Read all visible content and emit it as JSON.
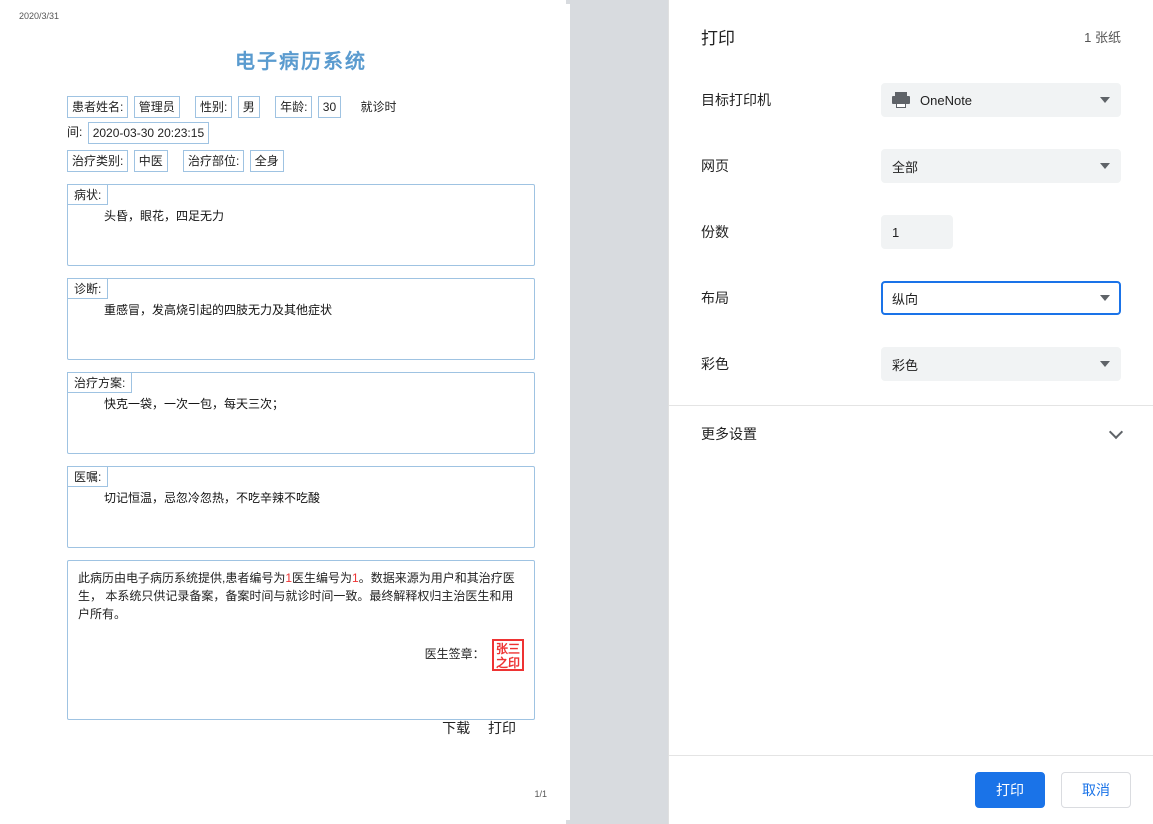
{
  "preview": {
    "date": "2020/3/31",
    "pageCounter": "1/1",
    "title": "电子病历系统",
    "patient": {
      "nameLabel": "患者姓名:",
      "nameValue": "管理员",
      "genderLabel": "性别:",
      "genderValue": "男",
      "ageLabel": "年龄:",
      "ageValue": "30",
      "visitTimeLabel1": "就诊时",
      "visitTimeLabel2": "间:",
      "visitTimeValue": "2020-03-30 20:23:15",
      "categoryLabel": "治疗类别:",
      "categoryValue": "中医",
      "partLabel": "治疗部位:",
      "partValue": "全身"
    },
    "sections": {
      "symptomLabel": "病状:",
      "symptomText": "头昏，眼花，四足无力",
      "diagnosisLabel": "诊断:",
      "diagnosisText": "重感冒，发高烧引起的四肢无力及其他症状",
      "planLabel": "治疗方案:",
      "planText": "快克一袋，一次一包，每天三次；",
      "orderLabel": "医嘱:",
      "orderText": "切记恒温，忌忽冷忽热，不吃辛辣不吃酸"
    },
    "footnote": {
      "p1a": "此病历由电子病历系统提供,患者编号为",
      "n1": "1",
      "p1b": "医生编号为",
      "n2": "1",
      "p1c": "。数据来源为用户和其治疗医生， 本系统只供记录备案，备案时间与就诊时间一致。最终解释权归主治医生和用户所有。",
      "sigLabel": "医生签章：",
      "stampLine1": "张三",
      "stampLine2": "之印"
    },
    "actions": {
      "download": "下载",
      "print": "打印"
    }
  },
  "panel": {
    "title": "打印",
    "pageCount": "1 张纸",
    "rows": {
      "destinationLabel": "目标打印机",
      "destinationValue": "OneNote",
      "pagesLabel": "网页",
      "pagesValue": "全部",
      "copiesLabel": "份数",
      "copiesValue": "1",
      "layoutLabel": "布局",
      "layoutValue": "纵向",
      "colorLabel": "彩色",
      "colorValue": "彩色"
    },
    "moreLabel": "更多设置",
    "footer": {
      "print": "打印",
      "cancel": "取消"
    }
  }
}
